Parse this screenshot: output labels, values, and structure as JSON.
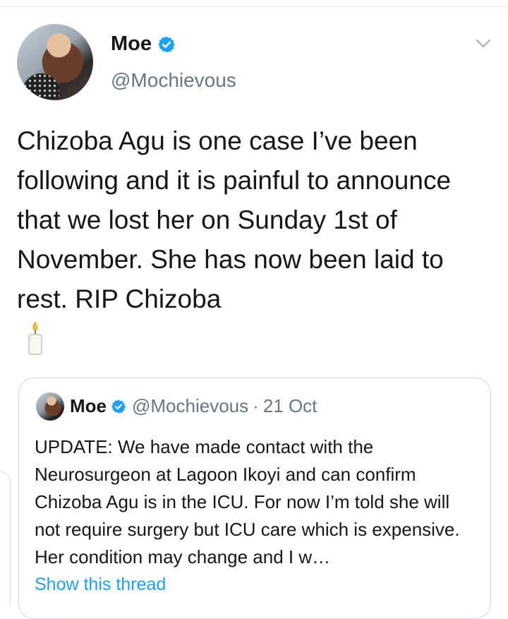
{
  "tweet": {
    "author_name": "Moe",
    "author_handle": "@Mochievous",
    "text": "Chizoba Agu is one case I’ve been following and it is painful to announce that we lost her on Sunday 1st of November. She has now been laid to rest. RIP Chizoba",
    "emoji_icon": "candle-icon"
  },
  "quoted_tweet": {
    "author_name": "Moe",
    "author_handle": "@Mochievous",
    "separator": "·",
    "date": "21 Oct",
    "text": "UPDATE: We have made contact with the Neurosurgeon at Lagoon Ikoyi and can confirm Chizoba Agu is in the ICU. For now I’m told she will not require surgery but ICU care which is expensive. Her condition may change and I w…",
    "show_thread_label": "Show this thread"
  },
  "colors": {
    "verified_blue": "#1da1f2",
    "secondary_text": "#657786",
    "border": "#ccd6dd"
  },
  "icons": [
    "verified-badge-icon",
    "chevron-down-icon",
    "candle-icon"
  ]
}
